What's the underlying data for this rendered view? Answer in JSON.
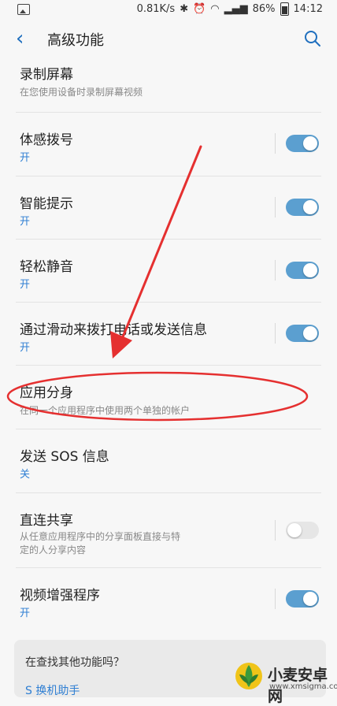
{
  "status": {
    "speed": "0.81K/s",
    "icons": [
      "bluetooth-icon",
      "alarm-icon",
      "wifi-icon",
      "signal-icon"
    ],
    "battery": "86%",
    "time": "14:12"
  },
  "header": {
    "title": "高级功能"
  },
  "rows": [
    {
      "label": "录制屏幕",
      "sub": "在您使用设备时录制屏幕视频"
    },
    {
      "label": "体感拨号",
      "state": "开",
      "toggle": true
    },
    {
      "label": "智能提示",
      "state": "开",
      "toggle": true
    },
    {
      "label": "轻松静音",
      "state": "开",
      "toggle": true
    },
    {
      "label": "通过滑动来拨打电话或发送信息",
      "state": "开",
      "toggle": true
    },
    {
      "label": "应用分身",
      "sub": "在同一个应用程序中使用两个单独的帐户"
    },
    {
      "label": "发送 SOS 信息",
      "state": "关"
    },
    {
      "label": "直连共享",
      "sub_line1": "从任意应用程序中的分享面板直接与特",
      "sub_line2": "定的人分享内容",
      "toggle": false
    },
    {
      "label": "视频增强程序",
      "state": "开",
      "toggle": true
    }
  ],
  "card": {
    "question": "在查找其他功能吗？",
    "link": "S 换机助手"
  },
  "watermark": {
    "name": "小麦安卓网",
    "url": "www.xmsigma.com"
  },
  "colors": {
    "accent": "#2f7fd3",
    "toggle_on": "#5b9fd0",
    "annotation": "#e53030"
  }
}
